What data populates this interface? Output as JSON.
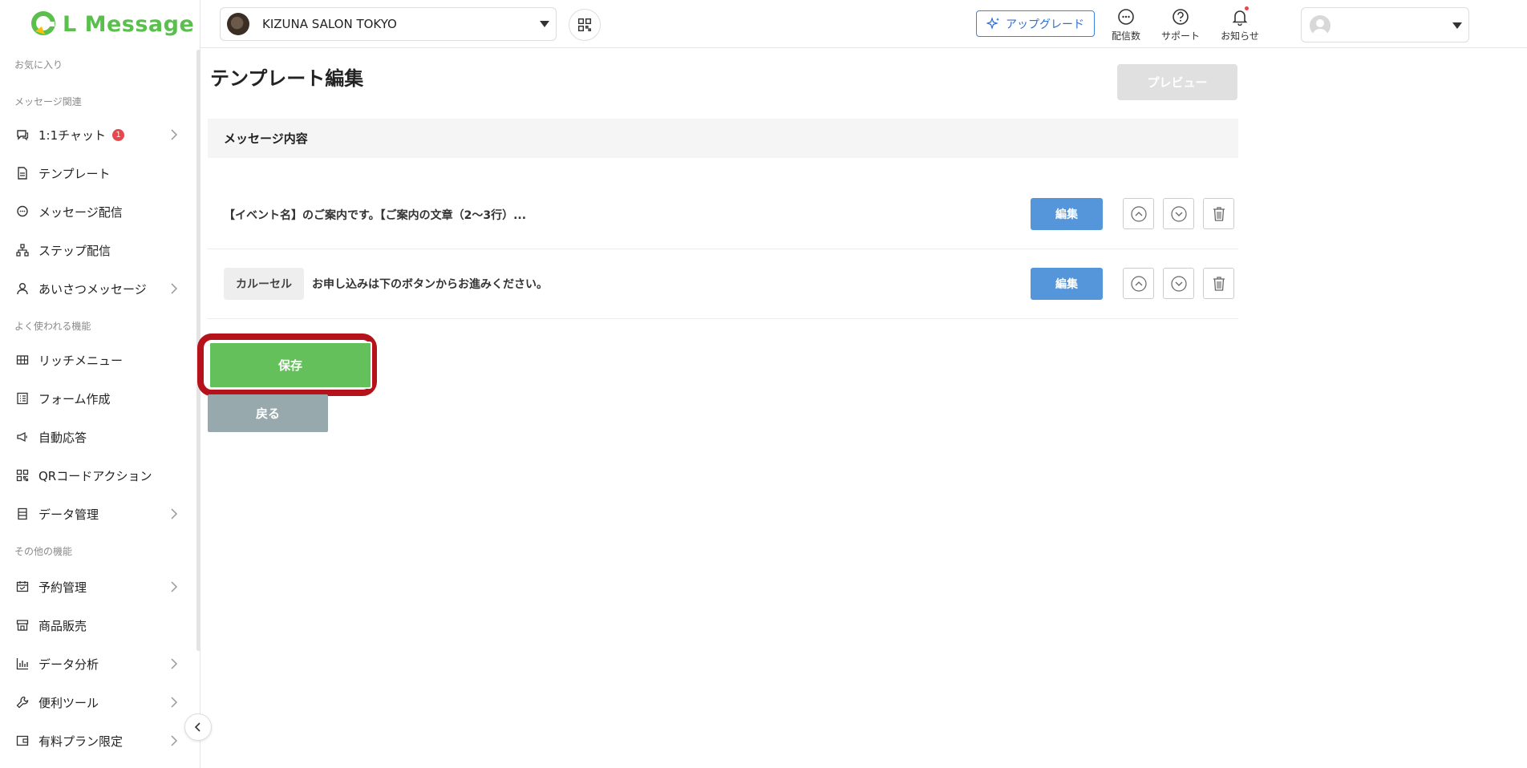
{
  "app": {
    "name": "L Message"
  },
  "colors": {
    "brand": "#5bbf4e",
    "accent": "#3b82e0",
    "edit": "#5596db",
    "save": "#63c05a",
    "highlight": "#b5121b"
  },
  "header": {
    "account": "KIZUNA SALON TOKYO",
    "upgrade_label": "アップグレード",
    "icons": [
      {
        "name": "message-count-icon",
        "label": "配信数"
      },
      {
        "name": "help-icon",
        "label": "サポート"
      },
      {
        "name": "bell-icon",
        "label": "お知らせ"
      }
    ]
  },
  "sidebar": {
    "favorites": "お気に入り",
    "sec_message": "メッセージ関連",
    "sec_common": "よく使われる機能",
    "sec_other": "その他の機能",
    "items": [
      {
        "label": "1:1チャット",
        "icon": "chat-icon",
        "badge": "1",
        "chevron": true
      },
      {
        "label": "テンプレート",
        "icon": "document-icon",
        "chevron": false
      },
      {
        "label": "メッセージ配信",
        "icon": "speech-bubble-icon",
        "chevron": false
      },
      {
        "label": "ステップ配信",
        "icon": "flow-icon",
        "chevron": false
      },
      {
        "label": "あいさつメッセージ",
        "icon": "user-icon",
        "chevron": true
      },
      {
        "label": "リッチメニュー",
        "icon": "grid-icon",
        "chevron": false
      },
      {
        "label": "フォーム作成",
        "icon": "form-icon",
        "chevron": false
      },
      {
        "label": "自動応答",
        "icon": "megaphone-icon",
        "chevron": false
      },
      {
        "label": "QRコードアクション",
        "icon": "qr-icon",
        "chevron": false
      },
      {
        "label": "データ管理",
        "icon": "list-icon",
        "chevron": true
      },
      {
        "label": "予約管理",
        "icon": "calendar-icon",
        "chevron": true
      },
      {
        "label": "商品販売",
        "icon": "store-icon",
        "chevron": false
      },
      {
        "label": "データ分析",
        "icon": "bar-chart-icon",
        "chevron": true
      },
      {
        "label": "便利ツール",
        "icon": "wrench-icon",
        "chevron": true
      },
      {
        "label": "有料プラン限定",
        "icon": "wallet-icon",
        "chevron": true
      }
    ]
  },
  "main": {
    "title": "テンプレート編集",
    "preview_label": "プレビュー",
    "section_title": "メッセージ内容",
    "rows": [
      {
        "text": "【イベント名】のご案内です。【ご案内の文章（2〜3行）...",
        "edit_label": "編集"
      },
      {
        "tag": "カルーセル",
        "text": "お申し込みは下のボタンからお進みください。",
        "edit_label": "編集"
      }
    ],
    "save_label": "保存",
    "back_label": "戻る"
  }
}
